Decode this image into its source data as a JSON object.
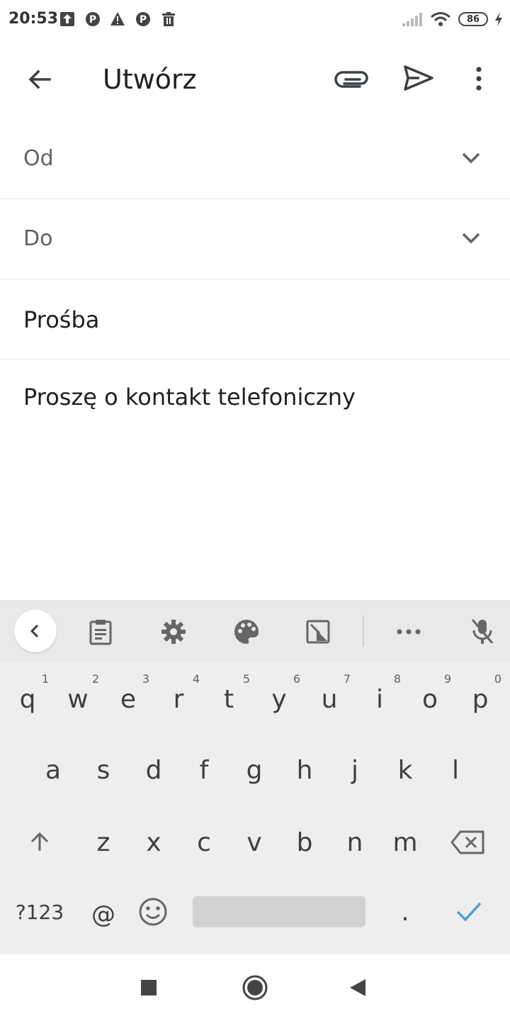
{
  "status_bar": {
    "time": "20:53",
    "battery": "86",
    "notif_icons": [
      "upload-icon",
      "parking-icon",
      "warning-icon",
      "parking-icon",
      "trash-icon"
    ],
    "right_icons": [
      "signal-icon",
      "wifi-icon",
      "battery-icon",
      "charging-icon"
    ]
  },
  "toolbar": {
    "title": "Utwórz",
    "back_icon": "arrow-back-icon",
    "attach_icon": "paperclip-icon",
    "send_icon": "send-icon",
    "more_icon": "more-vert-icon"
  },
  "fields": {
    "from_label": "Od",
    "to_label": "Do",
    "subject": "Prośba",
    "body": "Proszę o kontakt telefoniczny"
  },
  "keyboard": {
    "toolbar_icons": [
      "chevron-left-icon",
      "clipboard-icon",
      "gear-icon",
      "palette-icon",
      "resize-icon",
      "more-horiz-icon",
      "mic-off-icon"
    ],
    "row1": [
      "q",
      "w",
      "e",
      "r",
      "t",
      "y",
      "u",
      "i",
      "o",
      "p"
    ],
    "row1_hints": [
      "1",
      "2",
      "3",
      "4",
      "5",
      "6",
      "7",
      "8",
      "9",
      "0"
    ],
    "row2": [
      "a",
      "s",
      "d",
      "f",
      "g",
      "h",
      "j",
      "k",
      "l"
    ],
    "row3": [
      "z",
      "x",
      "c",
      "v",
      "b",
      "n",
      "m"
    ],
    "symbols_label": "?123",
    "at_label": "@",
    "period_label": ".",
    "accent_color": "#4a9fd6"
  },
  "nav_bar": {
    "icons": [
      "recents-square-icon",
      "home-circle-icon",
      "back-triangle-icon"
    ]
  }
}
